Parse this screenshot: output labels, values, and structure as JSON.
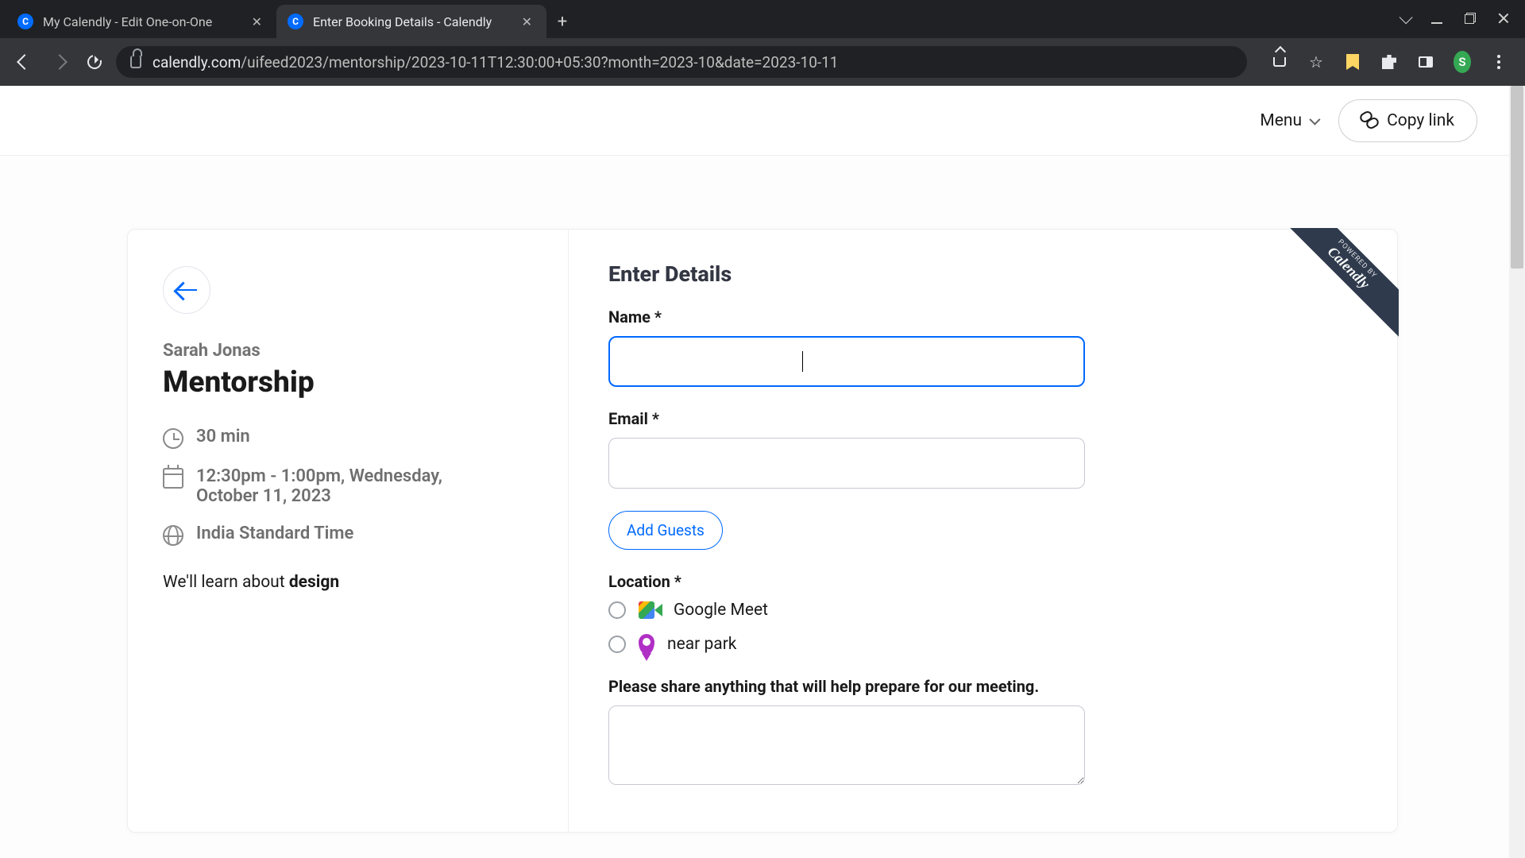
{
  "browser": {
    "tabs": [
      {
        "title": "My Calendly - Edit One-on-One",
        "active": false
      },
      {
        "title": "Enter Booking Details - Calendly",
        "active": true
      }
    ],
    "url_host": "calendly.com",
    "url_path": "/uifeed2023/mentorship/2023-10-11T12:30:00+05:30?month=2023-10&date=2023-10-11",
    "avatar_initial": "S"
  },
  "topbar": {
    "menu_label": "Menu",
    "copy_label": "Copy link"
  },
  "ribbon": {
    "small": "Powered by",
    "brand": "Calendly"
  },
  "event": {
    "host": "Sarah Jonas",
    "title": "Mentorship",
    "duration": "30 min",
    "when": "12:30pm - 1:00pm, Wednesday, October 11, 2023",
    "tz": "India Standard Time",
    "desc_prefix": "We'll learn about ",
    "desc_bold": "design"
  },
  "form": {
    "title": "Enter Details",
    "name_label": "Name *",
    "name_value": "",
    "email_label": "Email *",
    "email_value": "",
    "add_guests": "Add Guests",
    "location_label": "Location *",
    "loc_opt1": "Google Meet",
    "loc_opt2": "near park",
    "notes_label": "Please share anything that will help prepare for our meeting.",
    "notes_value": ""
  }
}
